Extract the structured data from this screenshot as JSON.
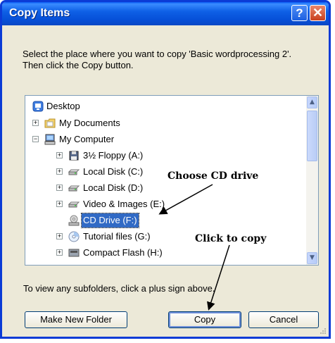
{
  "window": {
    "title": "Copy Items",
    "help_label": "?",
    "close_label": "✕"
  },
  "prompt": "Select the place where you want to copy 'Basic wordprocessing 2'. Then click the Copy button.",
  "tree": [
    {
      "label": "Desktop",
      "icon": "desktop-icon",
      "expander": ""
    },
    {
      "label": "My Documents",
      "icon": "folder-icon",
      "expander": "+"
    },
    {
      "label": "My Computer",
      "icon": "computer-icon",
      "expander": "−"
    },
    {
      "label": "3½ Floppy (A:)",
      "icon": "floppy-drive-icon",
      "expander": "+"
    },
    {
      "label": "Local Disk (C:)",
      "icon": "hard-disk-icon",
      "expander": "+"
    },
    {
      "label": "Local Disk (D:)",
      "icon": "hard-disk-icon",
      "expander": "+"
    },
    {
      "label": "Video & Images (E:)",
      "icon": "hard-disk-icon",
      "expander": "+"
    },
    {
      "label": "CD Drive (F:)",
      "icon": "cd-drive-icon",
      "expander": "",
      "selected": true
    },
    {
      "label": "Tutorial files (G:)",
      "icon": "dvd-icon",
      "expander": "+"
    },
    {
      "label": "Compact Flash (H:)",
      "icon": "removable-drive-icon",
      "expander": "+"
    }
  ],
  "hint": "To view any subfolders, click a plus sign above.",
  "buttons": {
    "make_new_folder": "Make New Folder",
    "copy": "Copy",
    "cancel": "Cancel"
  },
  "annotations": {
    "choose": "Choose CD drive",
    "click": "Click to copy"
  },
  "colors": {
    "titlebar": "#0650d8",
    "selection": "#316ac5",
    "dialog_bg": "#ece9d8"
  }
}
